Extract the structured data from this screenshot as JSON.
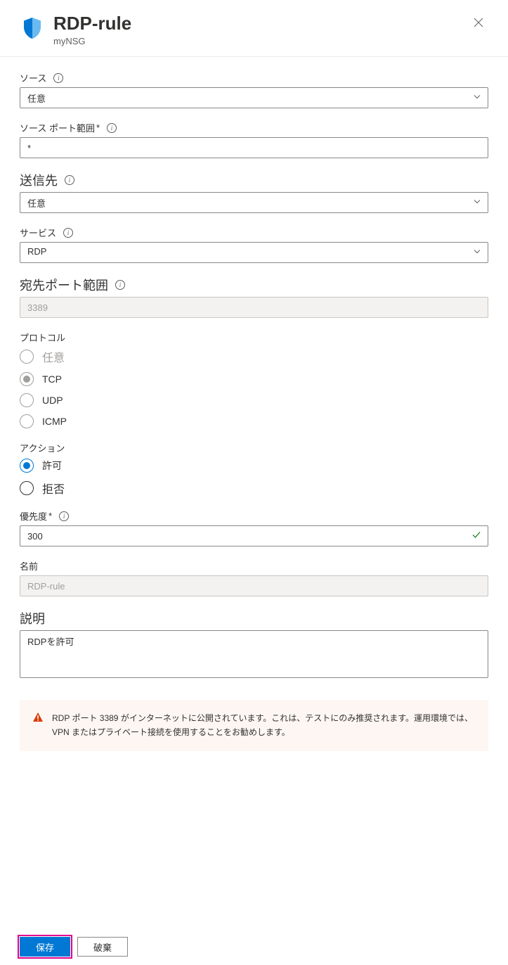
{
  "header": {
    "title": "RDP-rule",
    "subtitle": "myNSG"
  },
  "form": {
    "source": {
      "label": "ソース",
      "value": "任意"
    },
    "sourcePort": {
      "label": "ソース ポート範囲",
      "value": "*"
    },
    "destination": {
      "label": "送信先",
      "value": "任意"
    },
    "service": {
      "label": "サービス",
      "value": "RDP"
    },
    "destPort": {
      "label": "宛先ポート範囲",
      "value": "3389"
    },
    "protocol": {
      "label": "プロトコル",
      "options": {
        "any": "任意",
        "tcp": "TCP",
        "udp": "UDP",
        "icmp": "ICMP"
      },
      "selected": "tcp"
    },
    "action": {
      "label": "アクション",
      "options": {
        "allow": "許可",
        "deny": "拒否"
      },
      "selected": "allow"
    },
    "priority": {
      "label": "優先度",
      "value": "300"
    },
    "name": {
      "label": "名前",
      "value": "RDP-rule"
    },
    "description": {
      "label": "説明",
      "value": "RDPを許可"
    }
  },
  "warning": "RDP ポート 3389 がインターネットに公開されています。これは、テストにのみ推奨されます。運用環境では、VPN またはプライベート接続を使用することをお勧めします。",
  "footer": {
    "save": "保存",
    "discard": "破棄"
  }
}
